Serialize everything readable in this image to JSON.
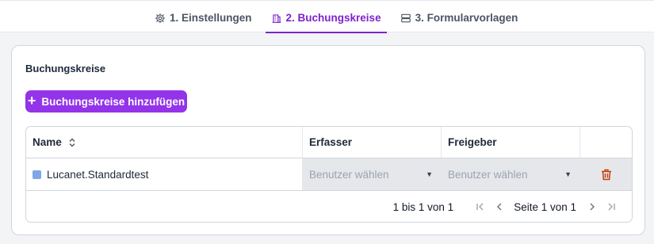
{
  "tabs": [
    {
      "label": "1. Einstellungen",
      "icon": "gear-icon",
      "active": false
    },
    {
      "label": "2. Buchungskreise",
      "icon": "building-icon",
      "active": true
    },
    {
      "label": "3. Formularvorlagen",
      "icon": "server-stack-icon",
      "active": false
    }
  ],
  "section": {
    "title": "Buchungskreise",
    "add_button_label": "Buchungskreise hinzufügen"
  },
  "table": {
    "columns": [
      "Name",
      "Erfasser",
      "Freigeber",
      ""
    ],
    "rows": [
      {
        "name": "Lucanet.Standardtest",
        "erfasser_placeholder": "Benutzer wählen",
        "freigeber_placeholder": "Benutzer wählen"
      }
    ]
  },
  "pagination": {
    "range_text": "1 bis 1 von 1",
    "page_text": "Seite 1 von 1"
  },
  "colors": {
    "accent": "#9333ea",
    "active_tab": "#7e22ce",
    "delete_icon": "#c2410c",
    "row_chip": "#7ea6e8"
  }
}
